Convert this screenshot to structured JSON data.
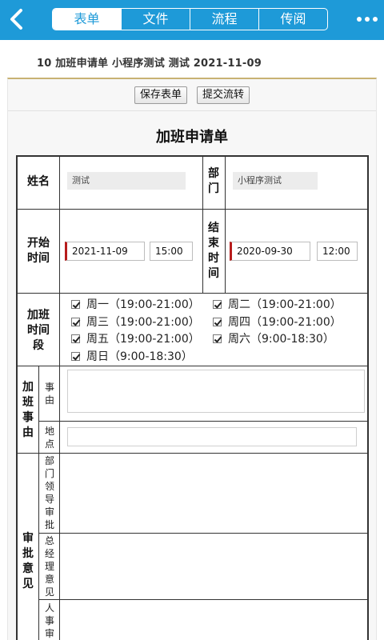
{
  "header": {
    "back_icon": "chevron-left-icon",
    "tabs": [
      {
        "label": "表单",
        "active": true
      },
      {
        "label": "文件",
        "active": false
      },
      {
        "label": "流程",
        "active": false
      },
      {
        "label": "传阅",
        "active": false
      }
    ],
    "more_icon": "more-dots-icon",
    "bg_color": "#1e9ad8"
  },
  "subtitle": "10 加班申请单 小程序测试 测试 2021-11-09",
  "actions": {
    "save_label": "保存表单",
    "submit_label": "提交流转"
  },
  "form": {
    "title": "加班申请单",
    "name_label": "姓名",
    "name_value": "测试",
    "dept_label": "部门",
    "dept_value": "小程序测试",
    "start_label": "开始时间",
    "start_date": "2021-11-09",
    "start_time": "15:00",
    "end_label": "结束时间",
    "end_date": "2020-09-30",
    "end_time": "12:00",
    "period_label": "加班时间段",
    "periods": [
      {
        "label": "周一（19:00-21:00）",
        "checked": true
      },
      {
        "label": "周二（19:00-21:00）",
        "checked": true
      },
      {
        "label": "周三（19:00-21:00）",
        "checked": true
      },
      {
        "label": "周四（19:00-21:00）",
        "checked": true
      },
      {
        "label": "周五（19:00-21:00）",
        "checked": true
      },
      {
        "label": "周六（9:00-18:30）",
        "checked": true
      },
      {
        "label": "周日（9:00-18:30）",
        "checked": true
      }
    ],
    "reason_group_label": "加班事由",
    "reason_label": "事由",
    "reason_value": "",
    "location_label": "地点",
    "location_value": "",
    "approval_group_label": "审批意见",
    "dept_leader_label": "部门领导审批",
    "gm_label": "总经理意见",
    "hr_label": "人事审"
  }
}
